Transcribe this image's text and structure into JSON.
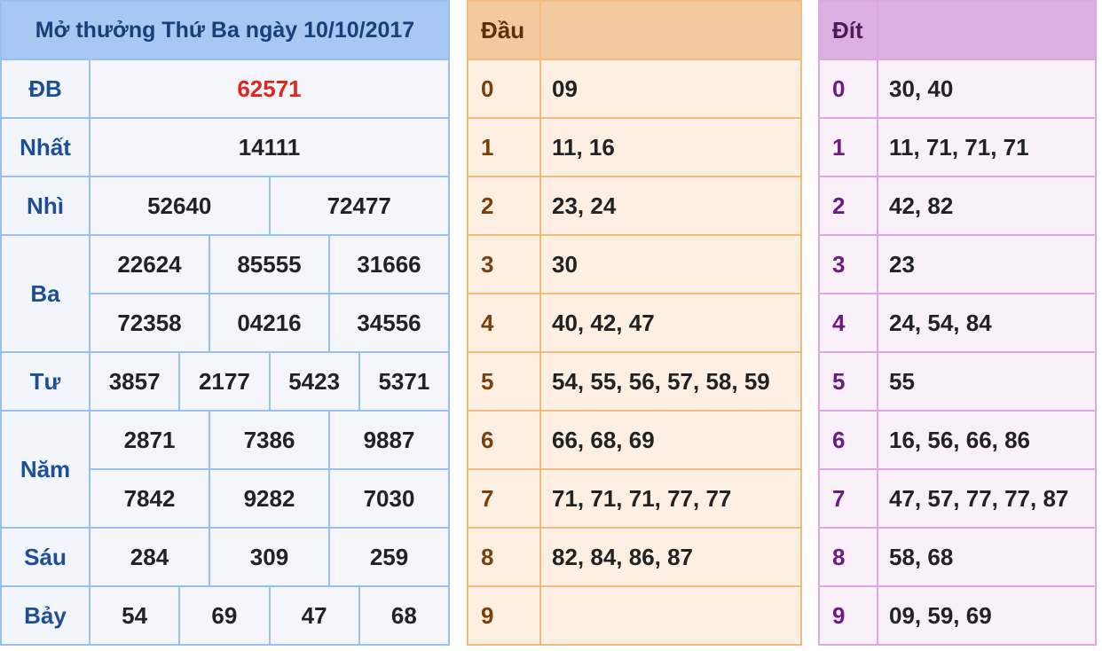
{
  "results": {
    "title": "Mở thưởng Thứ Ba ngày 10/10/2017",
    "rows": {
      "db": {
        "label": "ĐB",
        "numbers": [
          "62571"
        ]
      },
      "nhat": {
        "label": "Nhất",
        "numbers": [
          "14111"
        ]
      },
      "nhi": {
        "label": "Nhì",
        "numbers": [
          "52640",
          "72477"
        ]
      },
      "ba": {
        "label": "Ba",
        "numbers": [
          "22624",
          "85555",
          "31666",
          "72358",
          "04216",
          "34556"
        ]
      },
      "tu": {
        "label": "Tư",
        "numbers": [
          "3857",
          "2177",
          "5423",
          "5371"
        ]
      },
      "nam": {
        "label": "Năm",
        "numbers": [
          "2871",
          "7386",
          "9887",
          "7842",
          "9282",
          "7030"
        ]
      },
      "sau": {
        "label": "Sáu",
        "numbers": [
          "284",
          "309",
          "259"
        ]
      },
      "bay": {
        "label": "Bảy",
        "numbers": [
          "54",
          "69",
          "47",
          "68"
        ]
      }
    },
    "special_color": "#e0251c",
    "border_color": "#99bff0"
  },
  "dau": {
    "header": "Đầu",
    "rows": [
      {
        "key": "0",
        "values": "09"
      },
      {
        "key": "1",
        "values": "11, 16"
      },
      {
        "key": "2",
        "values": "23, 24"
      },
      {
        "key": "3",
        "values": "30"
      },
      {
        "key": "4",
        "values": "40, 42, 47"
      },
      {
        "key": "5",
        "values": "54, 55, 56, 57, 58, 59"
      },
      {
        "key": "6",
        "values": "66, 68, 69"
      },
      {
        "key": "7",
        "values": "71, 71, 71, 77, 77"
      },
      {
        "key": "8",
        "values": "82, 84, 86, 87"
      },
      {
        "key": "9",
        "values": ""
      }
    ],
    "border_color": "#f2bb80"
  },
  "dit": {
    "header": "Đít",
    "rows": [
      {
        "key": "0",
        "values": "30, 40"
      },
      {
        "key": "1",
        "values": "11, 71, 71, 71"
      },
      {
        "key": "2",
        "values": "42, 82"
      },
      {
        "key": "3",
        "values": "23"
      },
      {
        "key": "4",
        "values": "24, 54, 84"
      },
      {
        "key": "5",
        "values": "55"
      },
      {
        "key": "6",
        "values": "16, 56, 66, 86"
      },
      {
        "key": "7",
        "values": "47, 57, 77, 77, 87"
      },
      {
        "key": "8",
        "values": "58, 68"
      },
      {
        "key": "9",
        "values": "09, 59, 69"
      }
    ],
    "border_color": "#dda7df"
  }
}
